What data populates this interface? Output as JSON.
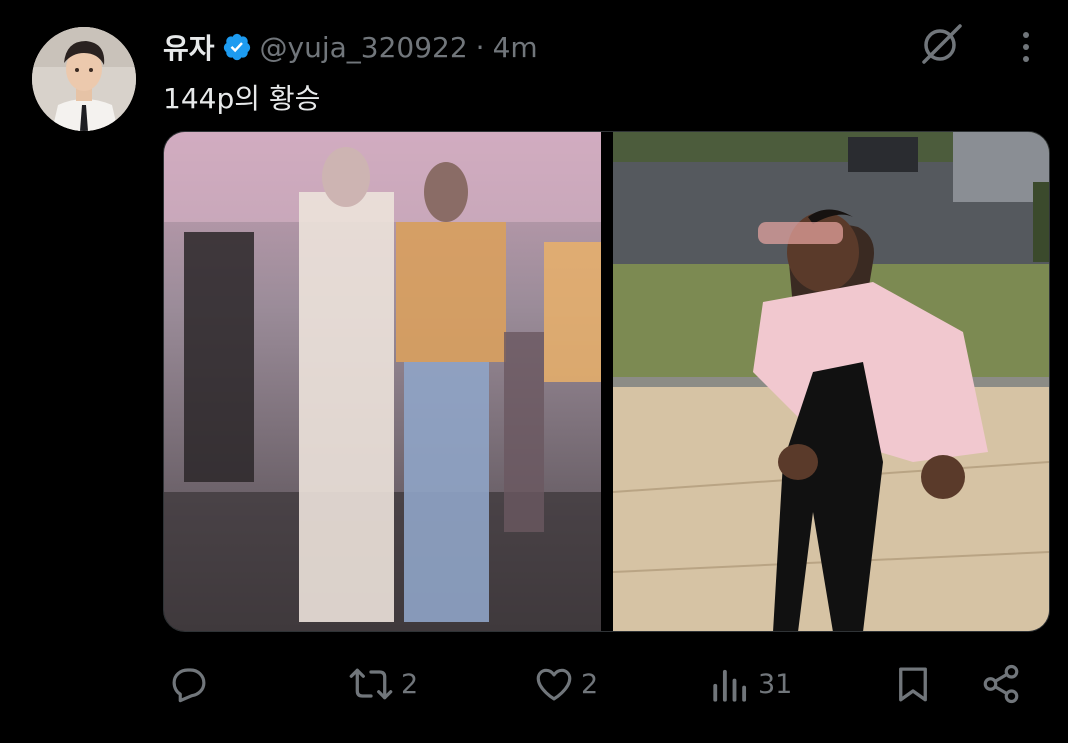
{
  "tweet": {
    "display_name": "유자",
    "handle": "@yuja_320922",
    "separator": "·",
    "time": "4m",
    "text": "144p의 황승"
  },
  "icons": {
    "verified": "verified-badge-icon",
    "grok": "grok-icon",
    "more": "more-vertical-icon",
    "reply": "reply-icon",
    "retweet": "retweet-icon",
    "like": "heart-icon",
    "views": "views-icon",
    "bookmark": "bookmark-icon",
    "share": "share-icon"
  },
  "actions": {
    "reply_count": "",
    "retweet_count": "2",
    "like_count": "2",
    "views_count": "31"
  },
  "colors": {
    "background": "#000000",
    "text": "#e7e9ea",
    "muted": "#71767b",
    "verified": "#1d9bf0"
  }
}
